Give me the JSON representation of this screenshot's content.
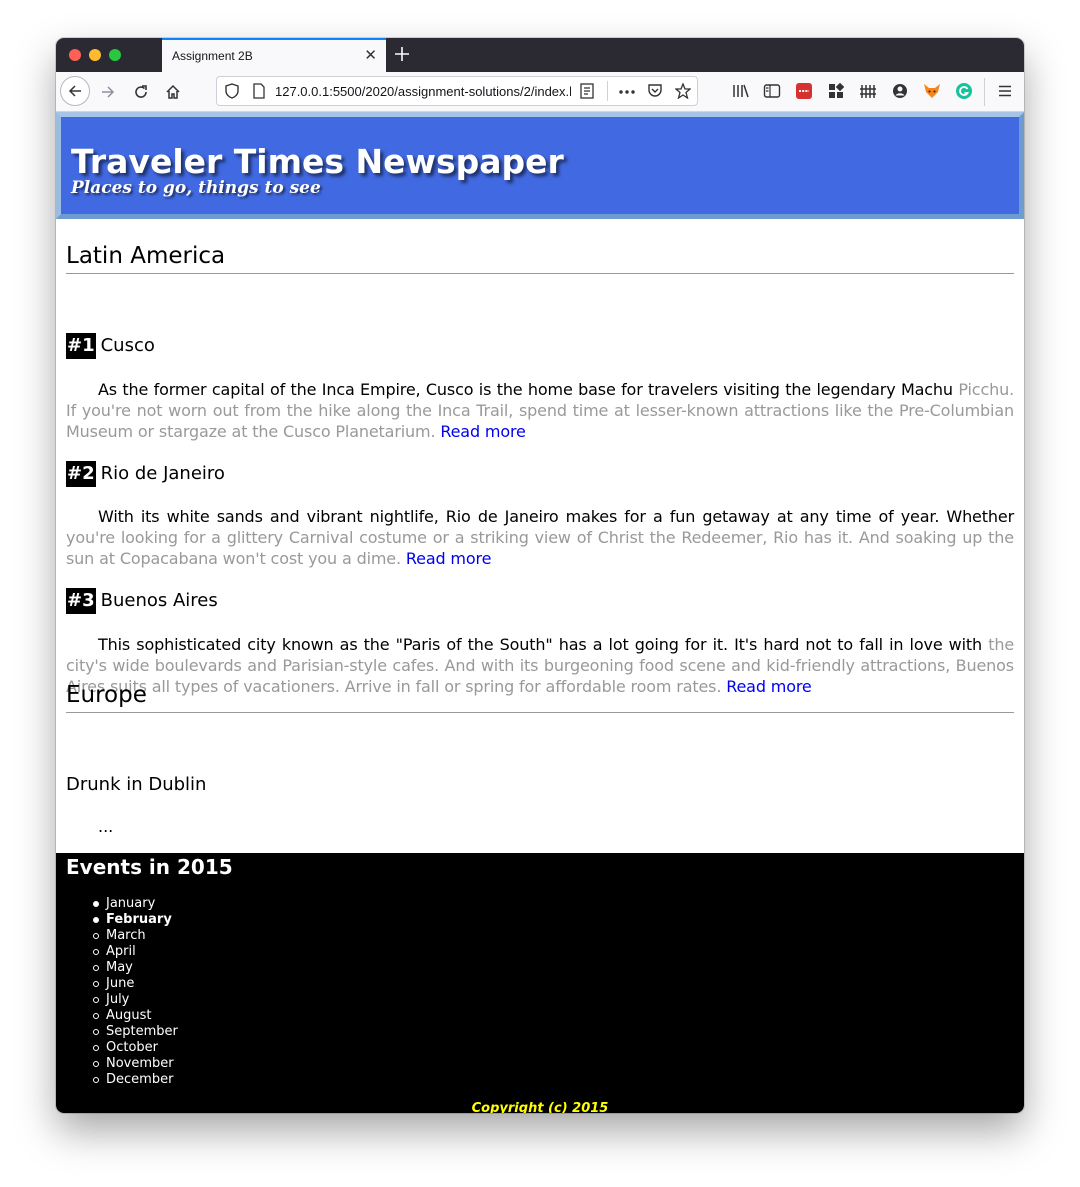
{
  "browser": {
    "tab_title": "Assignment 2B",
    "url": "127.0.0.1:5500/2020/assignment-solutions/2/index.html"
  },
  "masthead": {
    "title": "Traveler Times Newspaper",
    "subtitle": "Places to go, things to see"
  },
  "sections": [
    {
      "title": "Latin America",
      "articles": [
        {
          "rank": "#1",
          "title": "Cusco",
          "lead": "As the former capital of the Inca Empire, Cusco is the home base for travelers visiting the legendary Machu",
          "rest": "Picchu. If you're not worn out from the hike along the Inca Trail, spend time at lesser-known attractions like the Pre-Columbian Museum or stargaze at the Cusco Planetarium.",
          "link": "Read more"
        },
        {
          "rank": "#2",
          "title": "Rio de Janeiro",
          "lead": "With its white sands and vibrant nightlife, Rio de Janeiro makes for a fun getaway at any time of year. Whether",
          "rest": "you're looking for a glittery Carnival costume or a striking view of Christ the Redeemer, Rio has it. And soaking up the sun at Copacabana won't cost you a dime.",
          "link": "Read more"
        },
        {
          "rank": "#3",
          "title": "Buenos Aires",
          "lead": "This sophisticated city known as the \"Paris of the South\" has a lot going for it. It's hard not to fall in love with",
          "rest": "the city's wide boulevards and Parisian-style cafes. And with its burgeoning food scene and kid-friendly attractions, Buenos Aires suits all types of vacationers. Arrive in fall or spring for affordable room rates.",
          "link": "Read more"
        }
      ]
    },
    {
      "title": "Europe",
      "articles": [
        {
          "title": "Drunk in Dublin",
          "body": "..."
        }
      ]
    }
  ],
  "events": {
    "title": "Events in 2015",
    "months": [
      "January",
      "February",
      "March",
      "April",
      "May",
      "June",
      "July",
      "August",
      "September",
      "October",
      "November",
      "December"
    ]
  },
  "footer": {
    "copyright": "Copyright (c) 2015"
  }
}
